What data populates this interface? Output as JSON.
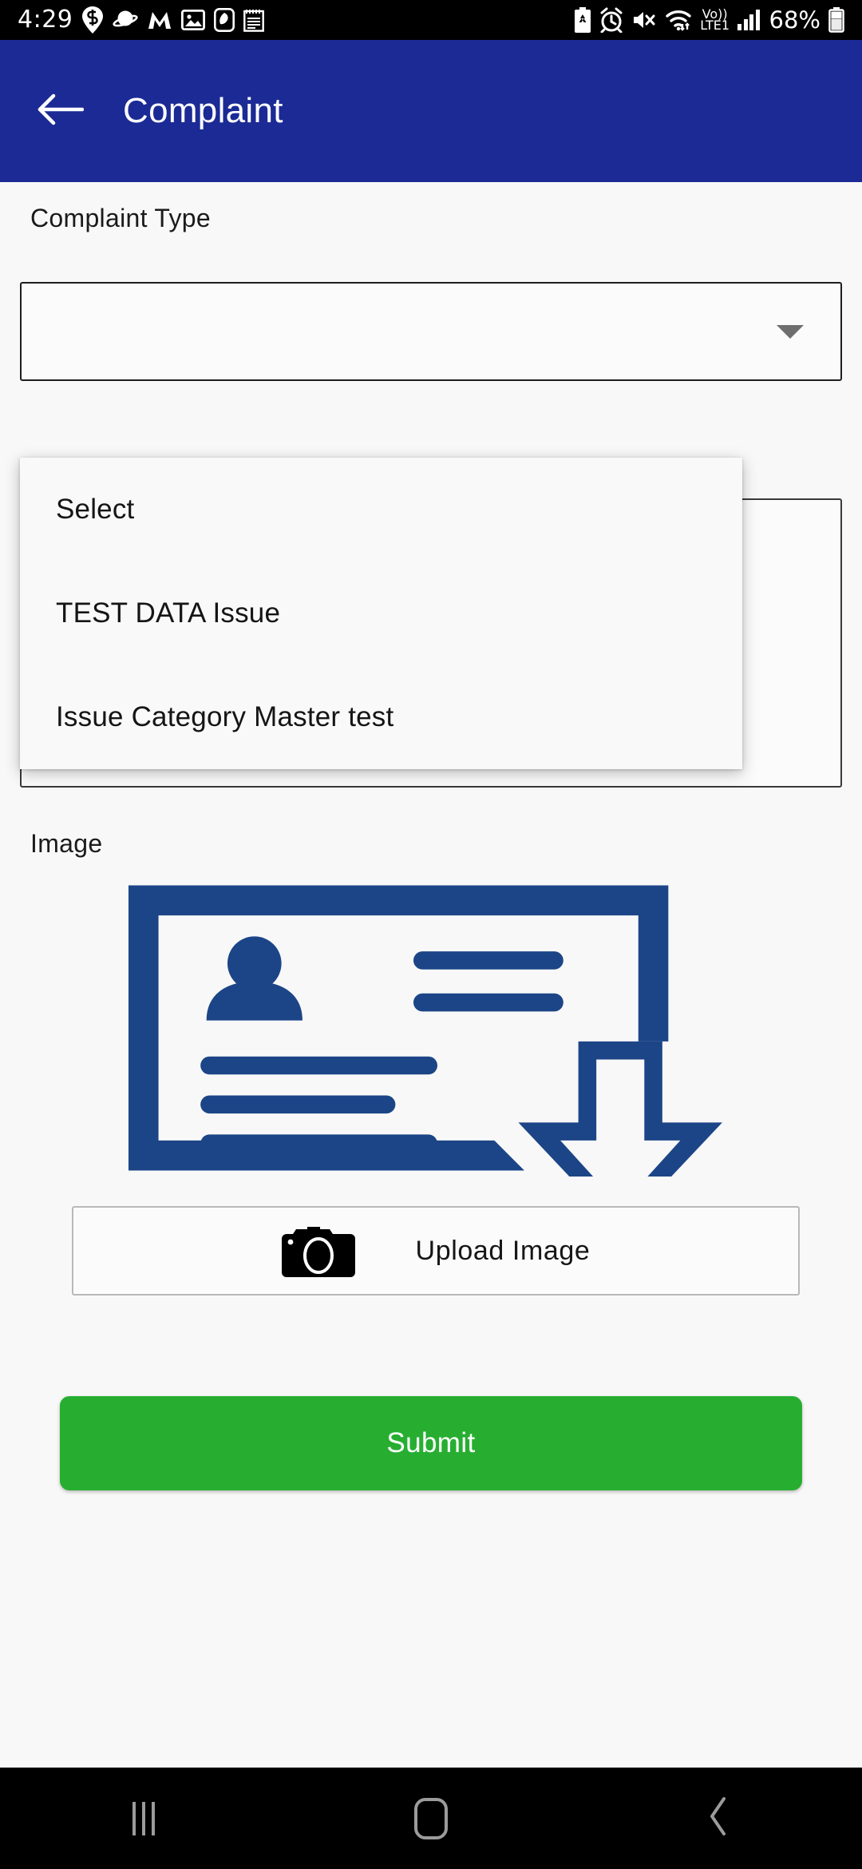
{
  "status_bar": {
    "time": "4:29",
    "battery_percent": "68%",
    "volte_top": "Vo))",
    "volte_bottom": "LTE1",
    "left_icons": [
      "location-pin-icon",
      "planet-icon",
      "m-app-icon",
      "gallery-icon",
      "leaf-app-icon",
      "notes-icon"
    ],
    "right_icons": [
      "battery-saver-icon",
      "alarm-icon",
      "mute-icon",
      "wifi-icon",
      "volte-icon",
      "signal-bars-icon",
      "battery-icon"
    ]
  },
  "app_bar": {
    "title": "Complaint",
    "back_icon": "arrow-left-icon",
    "background_color": "#1b2a95"
  },
  "form": {
    "complaint_type": {
      "label": "Complaint  Type",
      "selected_value": "",
      "caret_icon": "chevron-down-icon"
    },
    "description": {
      "value": "",
      "placeholder": ""
    },
    "image": {
      "label": "Image",
      "preview_icon": "image-placeholder-icon"
    },
    "upload": {
      "label": "Upload  Image",
      "icon": "camera-icon"
    },
    "submit": {
      "label": "Submit",
      "color": "#27ae31"
    }
  },
  "dropdown": {
    "open": true,
    "items": [
      {
        "label": "Select"
      },
      {
        "label": "TEST DATA Issue"
      },
      {
        "label": "Issue Category Master test"
      }
    ]
  },
  "nav_bar": {
    "recents_icon": "recents-icon",
    "home_icon": "home-icon",
    "back_icon": "nav-back-icon"
  }
}
